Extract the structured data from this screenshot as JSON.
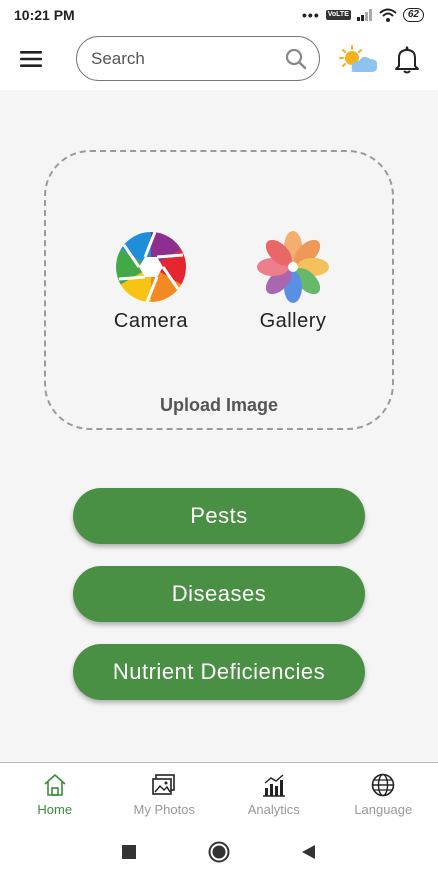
{
  "status_bar": {
    "time": "10:21 PM",
    "dots": "•••",
    "volte": "VoLTE",
    "battery": "62"
  },
  "app_bar": {
    "search_placeholder": "Search"
  },
  "upload": {
    "camera_label": "Camera",
    "gallery_label": "Gallery",
    "title": "Upload Image"
  },
  "actions": [
    {
      "label": "Pests"
    },
    {
      "label": "Diseases"
    },
    {
      "label": "Nutrient Deficiencies"
    }
  ],
  "bottom_nav": {
    "active": "Home",
    "items": [
      {
        "label": "Home",
        "icon": "home-icon"
      },
      {
        "label": "My Photos",
        "icon": "photos-icon"
      },
      {
        "label": "Analytics",
        "icon": "analytics-icon"
      },
      {
        "label": "Language",
        "icon": "globe-icon"
      }
    ]
  },
  "colors": {
    "primary": "#4a9044",
    "active_nav": "#3d8b3a",
    "inactive_nav": "#999999",
    "background": "#f5f5f5"
  }
}
